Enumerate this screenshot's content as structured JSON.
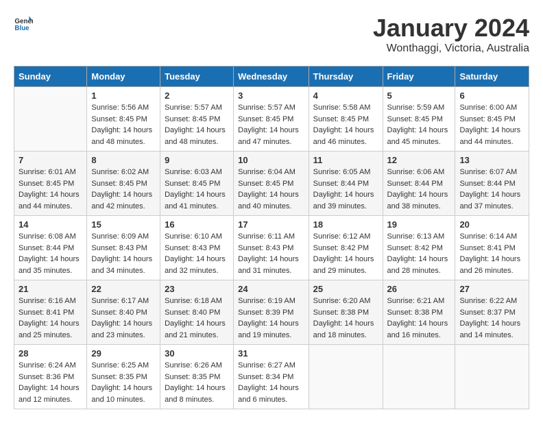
{
  "logo": {
    "general": "General",
    "blue": "Blue"
  },
  "title": {
    "month_year": "January 2024",
    "location": "Wonthaggi, Victoria, Australia"
  },
  "headers": [
    "Sunday",
    "Monday",
    "Tuesday",
    "Wednesday",
    "Thursday",
    "Friday",
    "Saturday"
  ],
  "weeks": [
    [
      {
        "day": "",
        "sunrise": "",
        "sunset": "",
        "daylight": ""
      },
      {
        "day": "1",
        "sunrise": "Sunrise: 5:56 AM",
        "sunset": "Sunset: 8:45 PM",
        "daylight": "Daylight: 14 hours and 48 minutes."
      },
      {
        "day": "2",
        "sunrise": "Sunrise: 5:57 AM",
        "sunset": "Sunset: 8:45 PM",
        "daylight": "Daylight: 14 hours and 48 minutes."
      },
      {
        "day": "3",
        "sunrise": "Sunrise: 5:57 AM",
        "sunset": "Sunset: 8:45 PM",
        "daylight": "Daylight: 14 hours and 47 minutes."
      },
      {
        "day": "4",
        "sunrise": "Sunrise: 5:58 AM",
        "sunset": "Sunset: 8:45 PM",
        "daylight": "Daylight: 14 hours and 46 minutes."
      },
      {
        "day": "5",
        "sunrise": "Sunrise: 5:59 AM",
        "sunset": "Sunset: 8:45 PM",
        "daylight": "Daylight: 14 hours and 45 minutes."
      },
      {
        "day": "6",
        "sunrise": "Sunrise: 6:00 AM",
        "sunset": "Sunset: 8:45 PM",
        "daylight": "Daylight: 14 hours and 44 minutes."
      }
    ],
    [
      {
        "day": "7",
        "sunrise": "Sunrise: 6:01 AM",
        "sunset": "Sunset: 8:45 PM",
        "daylight": "Daylight: 14 hours and 44 minutes."
      },
      {
        "day": "8",
        "sunrise": "Sunrise: 6:02 AM",
        "sunset": "Sunset: 8:45 PM",
        "daylight": "Daylight: 14 hours and 42 minutes."
      },
      {
        "day": "9",
        "sunrise": "Sunrise: 6:03 AM",
        "sunset": "Sunset: 8:45 PM",
        "daylight": "Daylight: 14 hours and 41 minutes."
      },
      {
        "day": "10",
        "sunrise": "Sunrise: 6:04 AM",
        "sunset": "Sunset: 8:45 PM",
        "daylight": "Daylight: 14 hours and 40 minutes."
      },
      {
        "day": "11",
        "sunrise": "Sunrise: 6:05 AM",
        "sunset": "Sunset: 8:44 PM",
        "daylight": "Daylight: 14 hours and 39 minutes."
      },
      {
        "day": "12",
        "sunrise": "Sunrise: 6:06 AM",
        "sunset": "Sunset: 8:44 PM",
        "daylight": "Daylight: 14 hours and 38 minutes."
      },
      {
        "day": "13",
        "sunrise": "Sunrise: 6:07 AM",
        "sunset": "Sunset: 8:44 PM",
        "daylight": "Daylight: 14 hours and 37 minutes."
      }
    ],
    [
      {
        "day": "14",
        "sunrise": "Sunrise: 6:08 AM",
        "sunset": "Sunset: 8:44 PM",
        "daylight": "Daylight: 14 hours and 35 minutes."
      },
      {
        "day": "15",
        "sunrise": "Sunrise: 6:09 AM",
        "sunset": "Sunset: 8:43 PM",
        "daylight": "Daylight: 14 hours and 34 minutes."
      },
      {
        "day": "16",
        "sunrise": "Sunrise: 6:10 AM",
        "sunset": "Sunset: 8:43 PM",
        "daylight": "Daylight: 14 hours and 32 minutes."
      },
      {
        "day": "17",
        "sunrise": "Sunrise: 6:11 AM",
        "sunset": "Sunset: 8:43 PM",
        "daylight": "Daylight: 14 hours and 31 minutes."
      },
      {
        "day": "18",
        "sunrise": "Sunrise: 6:12 AM",
        "sunset": "Sunset: 8:42 PM",
        "daylight": "Daylight: 14 hours and 29 minutes."
      },
      {
        "day": "19",
        "sunrise": "Sunrise: 6:13 AM",
        "sunset": "Sunset: 8:42 PM",
        "daylight": "Daylight: 14 hours and 28 minutes."
      },
      {
        "day": "20",
        "sunrise": "Sunrise: 6:14 AM",
        "sunset": "Sunset: 8:41 PM",
        "daylight": "Daylight: 14 hours and 26 minutes."
      }
    ],
    [
      {
        "day": "21",
        "sunrise": "Sunrise: 6:16 AM",
        "sunset": "Sunset: 8:41 PM",
        "daylight": "Daylight: 14 hours and 25 minutes."
      },
      {
        "day": "22",
        "sunrise": "Sunrise: 6:17 AM",
        "sunset": "Sunset: 8:40 PM",
        "daylight": "Daylight: 14 hours and 23 minutes."
      },
      {
        "day": "23",
        "sunrise": "Sunrise: 6:18 AM",
        "sunset": "Sunset: 8:40 PM",
        "daylight": "Daylight: 14 hours and 21 minutes."
      },
      {
        "day": "24",
        "sunrise": "Sunrise: 6:19 AM",
        "sunset": "Sunset: 8:39 PM",
        "daylight": "Daylight: 14 hours and 19 minutes."
      },
      {
        "day": "25",
        "sunrise": "Sunrise: 6:20 AM",
        "sunset": "Sunset: 8:38 PM",
        "daylight": "Daylight: 14 hours and 18 minutes."
      },
      {
        "day": "26",
        "sunrise": "Sunrise: 6:21 AM",
        "sunset": "Sunset: 8:38 PM",
        "daylight": "Daylight: 14 hours and 16 minutes."
      },
      {
        "day": "27",
        "sunrise": "Sunrise: 6:22 AM",
        "sunset": "Sunset: 8:37 PM",
        "daylight": "Daylight: 14 hours and 14 minutes."
      }
    ],
    [
      {
        "day": "28",
        "sunrise": "Sunrise: 6:24 AM",
        "sunset": "Sunset: 8:36 PM",
        "daylight": "Daylight: 14 hours and 12 minutes."
      },
      {
        "day": "29",
        "sunrise": "Sunrise: 6:25 AM",
        "sunset": "Sunset: 8:35 PM",
        "daylight": "Daylight: 14 hours and 10 minutes."
      },
      {
        "day": "30",
        "sunrise": "Sunrise: 6:26 AM",
        "sunset": "Sunset: 8:35 PM",
        "daylight": "Daylight: 14 hours and 8 minutes."
      },
      {
        "day": "31",
        "sunrise": "Sunrise: 6:27 AM",
        "sunset": "Sunset: 8:34 PM",
        "daylight": "Daylight: 14 hours and 6 minutes."
      },
      {
        "day": "",
        "sunrise": "",
        "sunset": "",
        "daylight": ""
      },
      {
        "day": "",
        "sunrise": "",
        "sunset": "",
        "daylight": ""
      },
      {
        "day": "",
        "sunrise": "",
        "sunset": "",
        "daylight": ""
      }
    ]
  ]
}
